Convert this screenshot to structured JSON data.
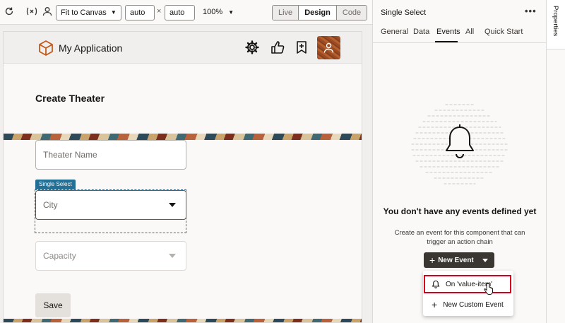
{
  "toolbar": {
    "fit_label": "Fit to Canvas",
    "width_value": "auto",
    "height_value": "auto",
    "times": "×",
    "zoom": "100%",
    "modes": [
      {
        "label": "Live"
      },
      {
        "label": "Design"
      },
      {
        "label": "Code"
      }
    ]
  },
  "app": {
    "title": "My Application"
  },
  "form": {
    "page_title": "Create Theater",
    "theater_name_placeholder": "Theater Name",
    "selection_badge": "Single Select",
    "city_placeholder": "City",
    "capacity_placeholder": "Capacity",
    "save_label": "Save"
  },
  "panel": {
    "title": "Single Select",
    "more": "•••",
    "tabs": [
      {
        "label": "General"
      },
      {
        "label": "Data"
      },
      {
        "label": "Events"
      },
      {
        "label": "All"
      },
      {
        "label": "Quick Start"
      }
    ],
    "active_tab": "Events",
    "empty_title": "You don't have any events defined yet",
    "empty_desc": "Create an event for this component that can trigger an action chain",
    "new_event_label": "New Event",
    "menu": [
      {
        "label": "On 'value-item'"
      },
      {
        "label": "New Custom Event"
      }
    ]
  },
  "strip": {
    "label": "Properties"
  },
  "colors": {
    "badge": "#227096",
    "highlight": "#d6001c",
    "button_dark": "#3a3632"
  }
}
